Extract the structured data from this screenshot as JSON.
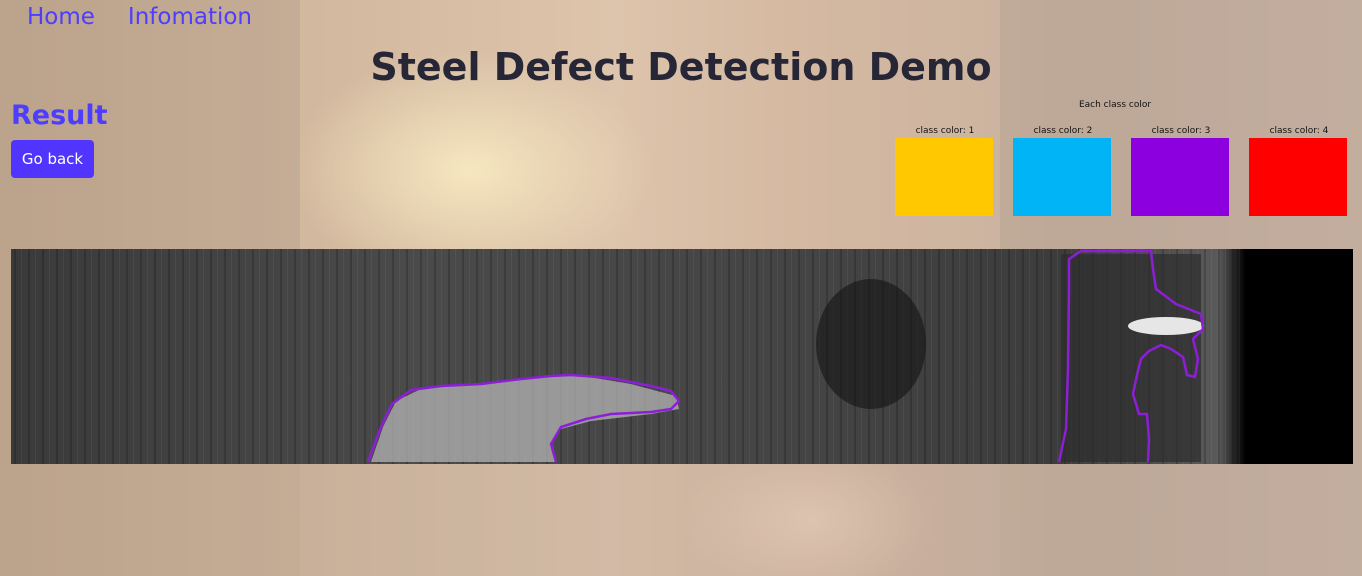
{
  "nav": {
    "home": "Home",
    "info": "Infomation"
  },
  "page_title": "Steel Defect Detection Demo",
  "result": {
    "heading": "Result",
    "go_back": "Go back"
  },
  "legend": {
    "title": "Each class color",
    "classes": [
      {
        "label": "class color: 1",
        "color": "#ffc800"
      },
      {
        "label": "class color: 2",
        "color": "#00b4f5"
      },
      {
        "label": "class color: 3",
        "color": "#8c00e0"
      },
      {
        "label": "class color: 4",
        "color": "#ff0000"
      }
    ]
  },
  "defect_outline_color": "#8c1fd6"
}
